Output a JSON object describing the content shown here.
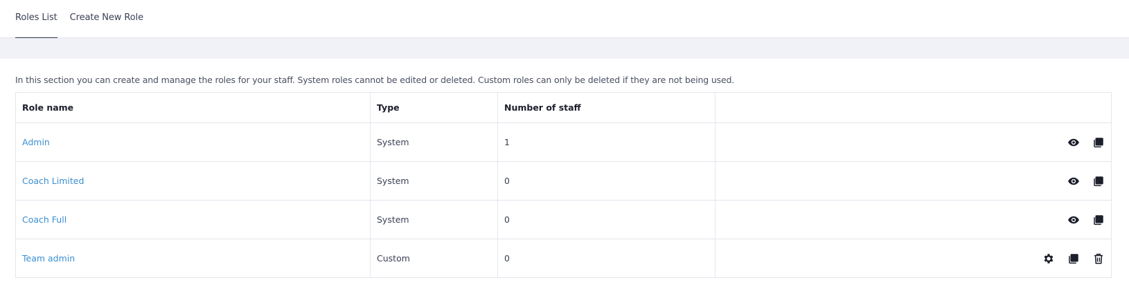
{
  "tabs": [
    {
      "label": "Roles List",
      "active": true
    },
    {
      "label": "Create New Role",
      "active": false
    }
  ],
  "intro_text": "In this section you can create and manage the roles for your staff. System roles cannot be edited or deleted. Custom roles can only be deleted if they are not being used.",
  "table": {
    "headers": {
      "role_name": "Role name",
      "type": "Type",
      "staff": "Number of staff",
      "actions": ""
    },
    "rows": [
      {
        "name": "Admin",
        "type": "System",
        "staff": "1",
        "actions": [
          "eye-icon",
          "copy-icon"
        ]
      },
      {
        "name": "Coach Limited",
        "type": "System",
        "staff": "0",
        "actions": [
          "eye-icon",
          "copy-icon"
        ]
      },
      {
        "name": "Coach Full",
        "type": "System",
        "staff": "0",
        "actions": [
          "eye-icon",
          "copy-icon"
        ]
      },
      {
        "name": "Team admin",
        "type": "Custom",
        "staff": "0",
        "actions": [
          "gear-icon",
          "copy-icon",
          "trash-icon"
        ]
      }
    ]
  },
  "colors": {
    "link": "#3a8fd0",
    "icon": "#1b1e2b",
    "band": "#f1f2f7",
    "border": "#e4e6ee"
  }
}
